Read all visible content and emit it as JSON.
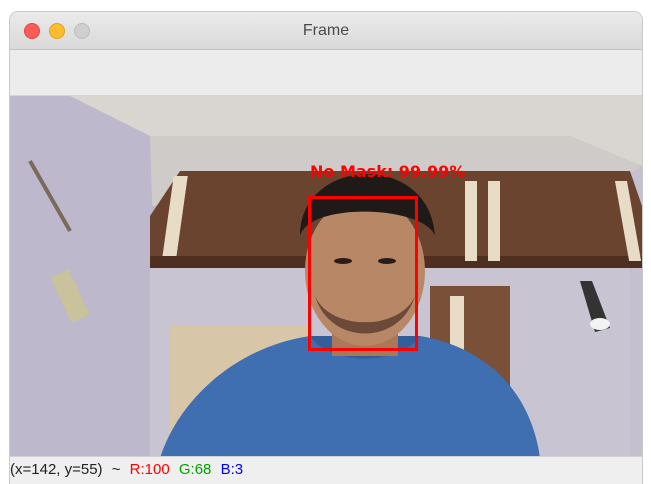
{
  "window": {
    "title": "Frame"
  },
  "detection": {
    "label": "No Mask: 99.99%",
    "color": "#ff0000"
  },
  "status_bar": {
    "coords": "(x=142, y=55)",
    "separator": "~",
    "r": "R:100",
    "g": "G:68",
    "b": "B:3",
    "colors": {
      "r": "#ff0000",
      "g": "#00a000",
      "b": "#0000ff"
    }
  },
  "icons": [
    "close-icon",
    "minimize-icon",
    "zoom-icon"
  ]
}
